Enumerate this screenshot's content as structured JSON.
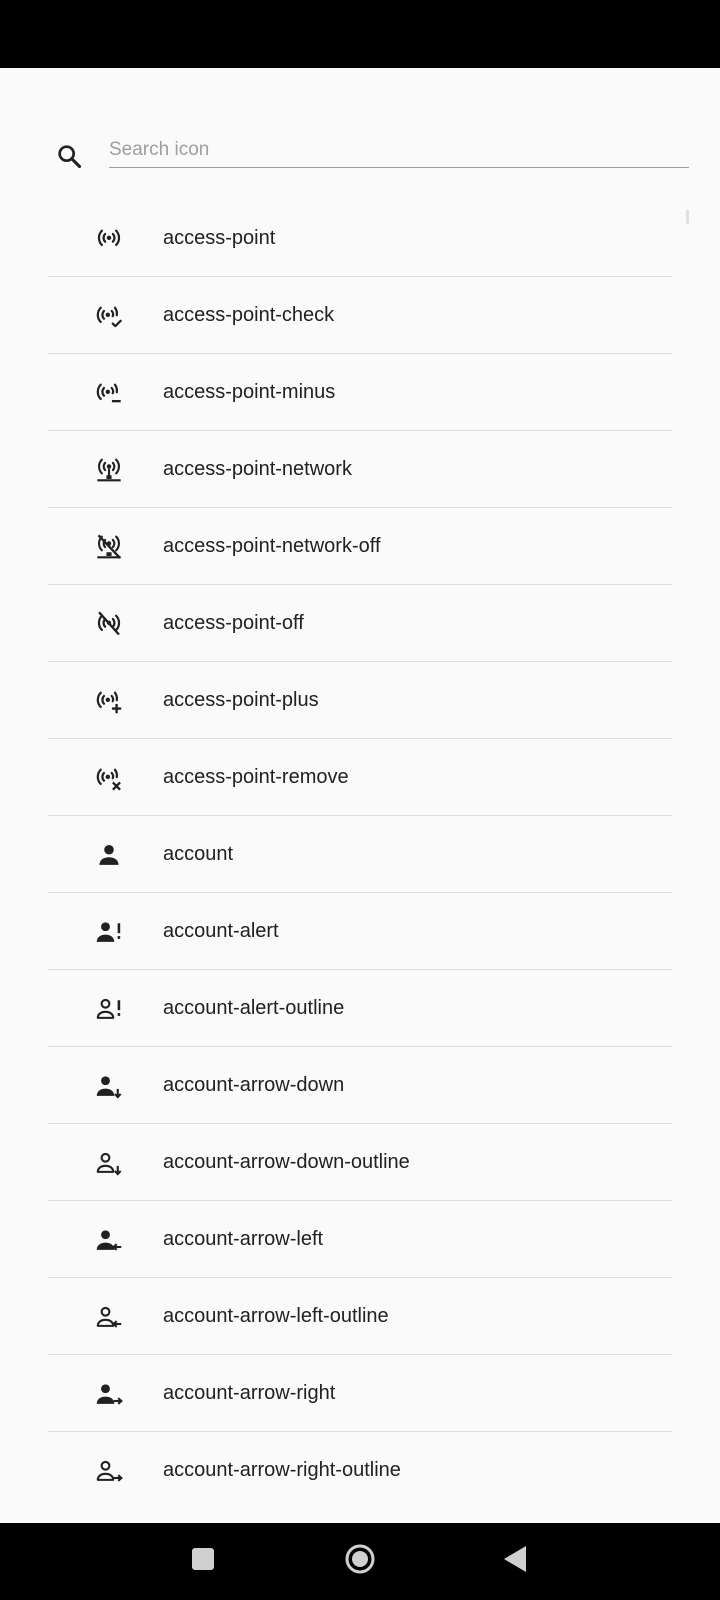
{
  "search": {
    "placeholder": "Search icon",
    "value": ""
  },
  "icons": [
    {
      "name": "access-point",
      "icon": "access-point-icon"
    },
    {
      "name": "access-point-check",
      "icon": "access-point-check-icon"
    },
    {
      "name": "access-point-minus",
      "icon": "access-point-minus-icon"
    },
    {
      "name": "access-point-network",
      "icon": "access-point-network-icon"
    },
    {
      "name": "access-point-network-off",
      "icon": "access-point-network-off-icon"
    },
    {
      "name": "access-point-off",
      "icon": "access-point-off-icon"
    },
    {
      "name": "access-point-plus",
      "icon": "access-point-plus-icon"
    },
    {
      "name": "access-point-remove",
      "icon": "access-point-remove-icon"
    },
    {
      "name": "account",
      "icon": "account-icon"
    },
    {
      "name": "account-alert",
      "icon": "account-alert-icon"
    },
    {
      "name": "account-alert-outline",
      "icon": "account-alert-outline-icon"
    },
    {
      "name": "account-arrow-down",
      "icon": "account-arrow-down-icon"
    },
    {
      "name": "account-arrow-down-outline",
      "icon": "account-arrow-down-outline-icon"
    },
    {
      "name": "account-arrow-left",
      "icon": "account-arrow-left-icon"
    },
    {
      "name": "account-arrow-left-outline",
      "icon": "account-arrow-left-outline-icon"
    },
    {
      "name": "account-arrow-right",
      "icon": "account-arrow-right-icon"
    },
    {
      "name": "account-arrow-right-outline",
      "icon": "account-arrow-right-outline-icon"
    }
  ],
  "nav": {
    "recents": "recents-square-icon",
    "home": "home-circle-icon",
    "back": "back-triangle-icon"
  },
  "colors": {
    "background": "#fafafa",
    "text": "#212121",
    "divider": "#dcdcdc",
    "system_bars": "#000000"
  }
}
